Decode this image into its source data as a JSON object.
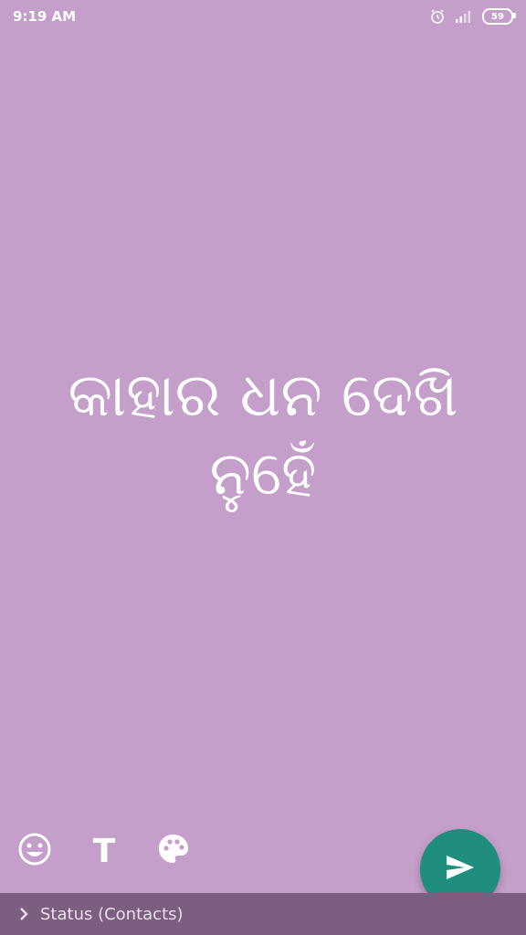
{
  "statusbar": {
    "time": "9:19 AM",
    "battery": "59",
    "icons": [
      "alarm-icon",
      "signal-icon",
      "battery-icon"
    ]
  },
  "status": {
    "text": "କାହାର ଧନ ଦେଖି ନୁହେଁ"
  },
  "tools": {
    "text_tool_label": "T",
    "icons": [
      "emoji-icon",
      "text-icon",
      "palette-icon"
    ]
  },
  "send": {
    "icon": "send-icon",
    "color": "#1f8e7e"
  },
  "footer": {
    "label": "Status (Contacts)",
    "icon": "chevron-right-icon"
  },
  "colors": {
    "background": "#c39fca",
    "footer": "#7c5f80",
    "fab": "#1f8e7e"
  }
}
